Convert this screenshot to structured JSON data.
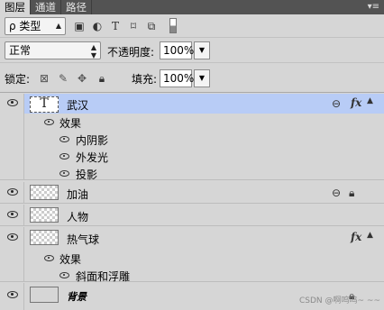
{
  "tabs": [
    {
      "label": "图层",
      "active": true
    },
    {
      "label": "通道",
      "active": false
    },
    {
      "label": "路径",
      "active": false
    }
  ],
  "filter": {
    "kind_label": "ρ 类型"
  },
  "blend": {
    "mode": "正常",
    "opacity_label": "不透明度:",
    "opacity_value": "100%"
  },
  "locks": {
    "label": "锁定:",
    "fill_label": "填充:",
    "fill_value": "100%"
  },
  "layers": [
    {
      "name": "武汉",
      "type": "text",
      "selected": true,
      "link": true,
      "fx": true,
      "effects_label": "效果",
      "effects": [
        "内阴影",
        "外发光",
        "投影"
      ]
    },
    {
      "name": "加油",
      "type": "raster",
      "link": true,
      "locked": true
    },
    {
      "name": "人物",
      "type": "raster"
    },
    {
      "name": "热气球",
      "type": "raster",
      "fx": true,
      "effects_label": "效果",
      "effects": [
        "斜面和浮雕"
      ]
    },
    {
      "name": "背景",
      "type": "background",
      "locked": true
    }
  ],
  "watermark": "CSDN @啊呜呜~ ~~",
  "colors": {
    "selection": "#b8ccf6",
    "panel": "#d6d6d6",
    "tabbar": "#535353"
  }
}
